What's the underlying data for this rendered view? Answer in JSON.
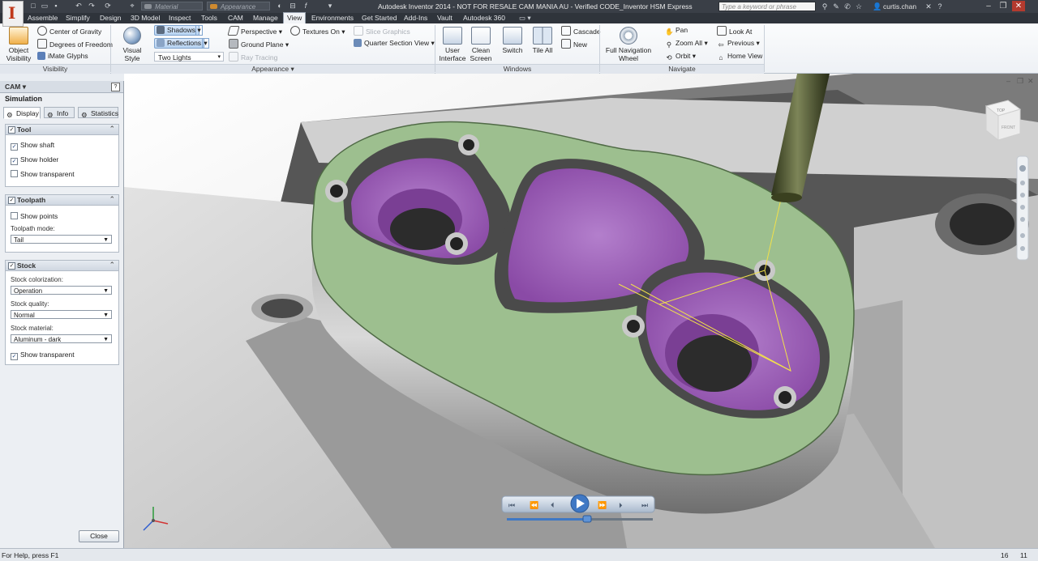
{
  "titlebar": {
    "title": "Autodesk Inventor 2014 - NOT FOR RESALE   CAM MANIA AU - Verified CODE_Inventor HSM Express",
    "search_placeholder": "Type a keyword or phrase",
    "user": "curtis.chan",
    "material_combo": "Material",
    "appearance_combo": "Appearance",
    "app_logo": "I"
  },
  "tabs": [
    "Assemble",
    "Simplify",
    "Design",
    "3D Model",
    "Inspect",
    "Tools",
    "CAM",
    "Manage",
    "View",
    "Environments",
    "Get Started",
    "Add-Ins",
    "Vault",
    "Autodesk 360"
  ],
  "active_tab": "View",
  "ribbon": {
    "visibility": {
      "label": "Visibility",
      "object_visibility": "Object\nVisibility",
      "center_of_gravity": "Center of Gravity",
      "degrees_of_freedom": "Degrees of Freedom",
      "imate_glyphs": "iMate Glyphs"
    },
    "appearance": {
      "label": "Appearance",
      "visual_style": "Visual Style",
      "shadows": "Shadows",
      "reflections": "Reflections",
      "lighting": "Two Lights",
      "perspective": "Perspective",
      "ground_plane": "Ground Plane",
      "ray_tracing": "Ray Tracing",
      "textures_on": "Textures On",
      "slice_graphics": "Slice Graphics",
      "quarter_section": "Quarter Section View"
    },
    "windows": {
      "label": "Windows",
      "user_interface": "User\nInterface",
      "clean_screen": "Clean\nScreen",
      "switch": "Switch",
      "tile_all": "Tile All",
      "cascade": "Cascade",
      "new": "New"
    },
    "navigate": {
      "label": "Navigate",
      "full_navigation_wheel": "Full Navigation\nWheel",
      "pan": "Pan",
      "zoom_all": "Zoom All",
      "orbit": "Orbit",
      "look_at": "Look At",
      "previous": "Previous",
      "home_view": "Home View"
    }
  },
  "panel": {
    "header": "CAM",
    "title": "Simulation",
    "tabs": [
      "Display",
      "Info",
      "Statistics"
    ],
    "tool": {
      "title": "Tool",
      "show_shaft": "Show shaft",
      "show_holder": "Show holder",
      "show_transparent": "Show transparent"
    },
    "toolpath": {
      "title": "Toolpath",
      "show_points": "Show points",
      "mode_label": "Toolpath mode:",
      "mode_value": "Tail"
    },
    "stock": {
      "title": "Stock",
      "colorization_label": "Stock colorization:",
      "colorization_value": "Operation",
      "quality_label": "Stock quality:",
      "quality_value": "Normal",
      "material_label": "Stock material:",
      "material_value": "Aluminum - dark",
      "show_transparent": "Show transparent"
    },
    "close": "Close"
  },
  "viewcube": {
    "face_top": "TOP",
    "face_front": "FRONT"
  },
  "status": {
    "help": "For Help, press F1",
    "num1": "16",
    "num2": "11"
  },
  "playback": {
    "progress": 0.55
  },
  "colors": {
    "pocket": "#9b5fb5",
    "part_face": "#9dbf8f",
    "ribbon_dark": "#3a3f47",
    "tool": "#4d5530"
  }
}
